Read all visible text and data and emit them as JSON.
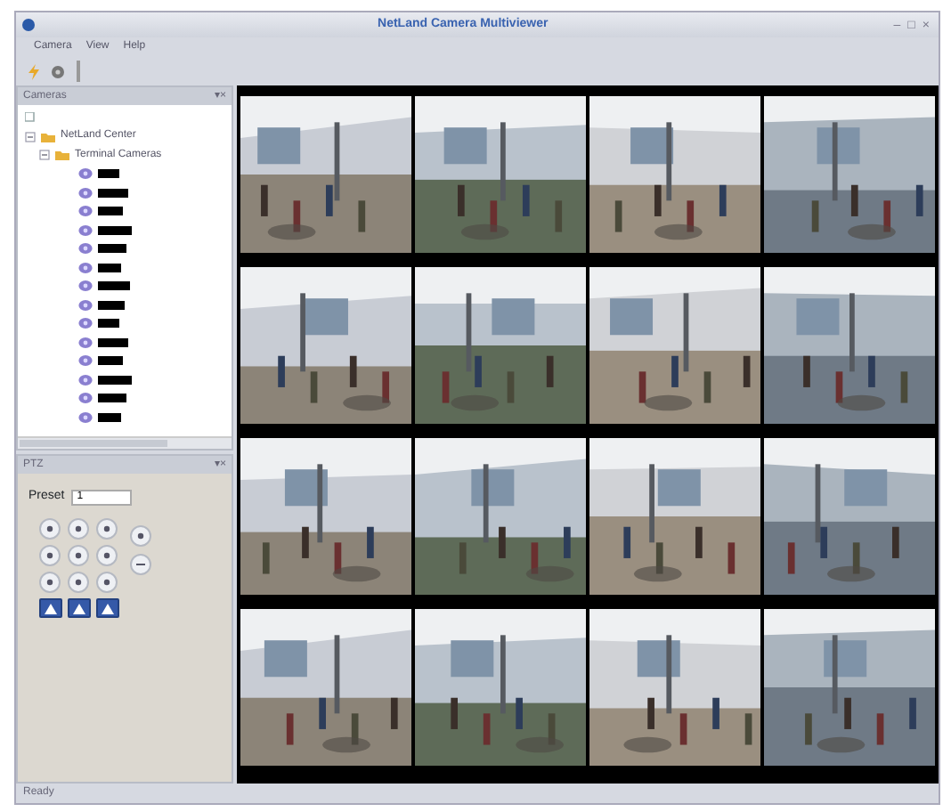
{
  "window": {
    "title": "NetLand Camera Multiviewer",
    "controls": [
      "–",
      "□",
      "×"
    ]
  },
  "menu": [
    "Camera",
    "View",
    "Help"
  ],
  "camera_panel": {
    "title": "Cameras",
    "controls": [
      "▾",
      "×"
    ],
    "tree": [
      {
        "label": "NetLand Center",
        "kind": "folder",
        "expanded": true,
        "children": [
          {
            "label": "Terminal Cameras",
            "kind": "folder",
            "expanded": true,
            "children": [
              {
                "kind": "camera"
              },
              {
                "kind": "camera"
              },
              {
                "kind": "camera"
              },
              {
                "kind": "camera"
              },
              {
                "kind": "camera"
              },
              {
                "kind": "camera"
              },
              {
                "kind": "camera"
              },
              {
                "kind": "camera"
              },
              {
                "kind": "camera"
              },
              {
                "kind": "camera"
              },
              {
                "kind": "camera"
              },
              {
                "kind": "camera"
              },
              {
                "kind": "camera"
              },
              {
                "kind": "camera"
              }
            ]
          }
        ]
      }
    ]
  },
  "ptz_panel": {
    "title": "PTZ",
    "controls": [
      "▾",
      "×"
    ],
    "preset_label": "Preset",
    "preset_value": "1"
  },
  "video_grid": {
    "rows": [
      [
        {
          "kind": "picture"
        },
        {
          "kind": "picture"
        },
        {
          "kind": "picture"
        },
        {
          "kind": "picture"
        }
      ],
      [
        {
          "kind": "picture"
        },
        {
          "kind": "picture"
        },
        {
          "kind": "picture"
        },
        {
          "kind": "picture"
        }
      ],
      [
        {
          "kind": "picture"
        },
        {
          "kind": "picture"
        },
        {
          "kind": "picture"
        },
        {
          "kind": "picture"
        }
      ],
      [
        {
          "kind": "picture"
        },
        {
          "kind": "picture"
        },
        {
          "kind": "picture"
        },
        {
          "kind": "picture"
        }
      ]
    ]
  },
  "status_bar": {
    "text": "Ready"
  }
}
